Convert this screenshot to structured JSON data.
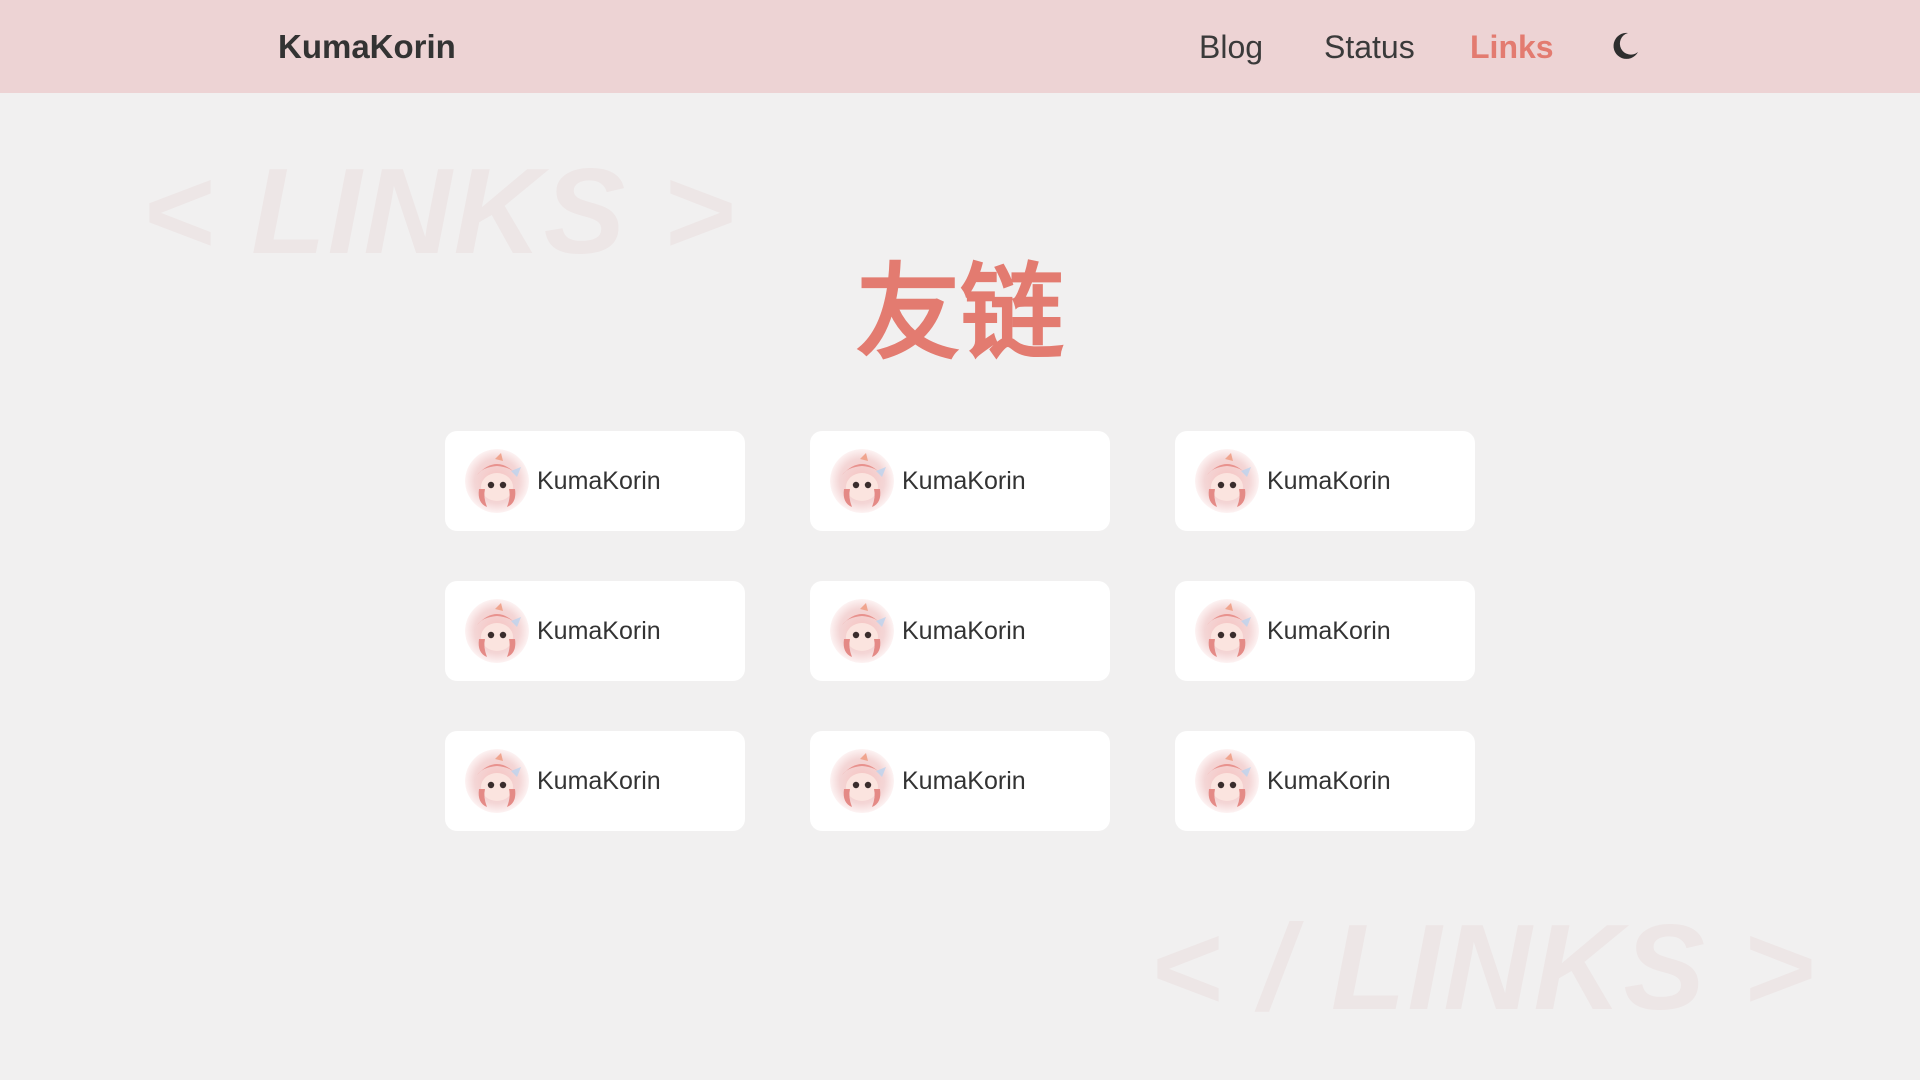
{
  "header": {
    "brand": "KumaKorin",
    "nav": [
      {
        "label": "Blog",
        "active": false
      },
      {
        "label": "Status",
        "active": false
      },
      {
        "label": "Links",
        "active": true
      }
    ],
    "theme_toggle_icon": "moon-icon"
  },
  "watermarks": {
    "top": "< LINKS >",
    "bottom": "< / LINKS >"
  },
  "page_title": "友链",
  "links": [
    {
      "name": "KumaKorin",
      "avatar_icon": "avatar-image"
    },
    {
      "name": "KumaKorin",
      "avatar_icon": "avatar-image"
    },
    {
      "name": "KumaKorin",
      "avatar_icon": "avatar-image"
    },
    {
      "name": "KumaKorin",
      "avatar_icon": "avatar-image"
    },
    {
      "name": "KumaKorin",
      "avatar_icon": "avatar-image"
    },
    {
      "name": "KumaKorin",
      "avatar_icon": "avatar-image"
    },
    {
      "name": "KumaKorin",
      "avatar_icon": "avatar-image"
    },
    {
      "name": "KumaKorin",
      "avatar_icon": "avatar-image"
    },
    {
      "name": "KumaKorin",
      "avatar_icon": "avatar-image"
    }
  ],
  "colors": {
    "accent": "#e37b70",
    "header_bg": "#edd3d4",
    "page_bg": "#f1f0f0",
    "text": "#333333",
    "watermark": "#ede6e6"
  }
}
